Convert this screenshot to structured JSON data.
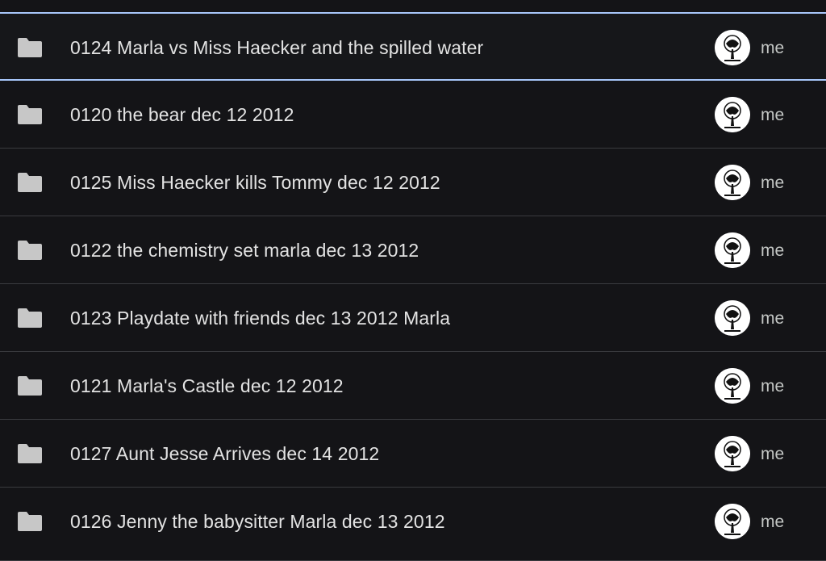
{
  "files": [
    {
      "name": "0124 Marla vs Miss Haecker and the spilled water",
      "owner": "me",
      "icon": "folder-icon",
      "selected": true
    },
    {
      "name": "0120 the bear dec 12 2012",
      "owner": "me",
      "icon": "folder-icon",
      "selected": false
    },
    {
      "name": "0125 Miss Haecker kills Tommy dec 12 2012",
      "owner": "me",
      "icon": "folder-icon",
      "selected": false
    },
    {
      "name": "0122 the chemistry set marla dec 13 2012",
      "owner": "me",
      "icon": "folder-icon",
      "selected": false
    },
    {
      "name": "0123 Playdate with friends dec 13 2012 Marla",
      "owner": "me",
      "icon": "folder-icon",
      "selected": false
    },
    {
      "name": "0121 Marla's Castle dec 12 2012",
      "owner": "me",
      "icon": "folder-icon",
      "selected": false
    },
    {
      "name": "0127 Aunt Jesse Arrives dec 14 2012",
      "owner": "me",
      "icon": "folder-icon",
      "selected": false
    },
    {
      "name": "0126 Jenny the babysitter Marla dec 13 2012",
      "owner": "me",
      "icon": "folder-icon",
      "selected": false
    }
  ],
  "colors": {
    "background": "#141417",
    "text": "#e3e3e3",
    "owner_text": "#c4c7c5",
    "divider": "#3a3b3f",
    "selection_border": "#a8c7fa",
    "folder": "#c7c7c7"
  }
}
